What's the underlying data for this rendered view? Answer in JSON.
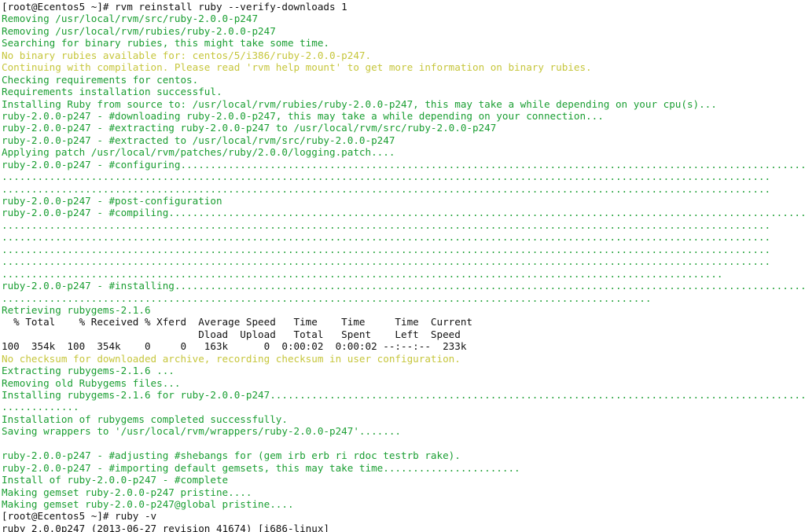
{
  "terminal": {
    "background_color": "#ffffff",
    "colors": {
      "green": "#1a9e32",
      "yellow": "#c6c63c",
      "black": "#111111"
    },
    "prompt": "[root@Ecentos5 ~]#",
    "hostname": "Ecentos5",
    "user": "root",
    "cwd": "~",
    "commands": [
      "rvm reinstall ruby --verify-downloads 1",
      "ruby -v"
    ],
    "lines": [
      {
        "color": "black",
        "text": "[root@Ecentos5 ~]# rvm reinstall ruby --verify-downloads 1"
      },
      {
        "color": "green",
        "text": "Removing /usr/local/rvm/src/ruby-2.0.0-p247"
      },
      {
        "color": "green",
        "text": "Removing /usr/local/rvm/rubies/ruby-2.0.0-p247"
      },
      {
        "color": "green",
        "text": "Searching for binary rubies, this might take some time."
      },
      {
        "color": "yellow",
        "text": "No binary rubies available for: centos/5/i386/ruby-2.0.0-p247."
      },
      {
        "color": "yellow",
        "text": "Continuing with compilation. Please read 'rvm help mount' to get more information on binary rubies."
      },
      {
        "color": "green",
        "text": "Checking requirements for centos."
      },
      {
        "color": "green",
        "text": "Requirements installation successful."
      },
      {
        "color": "green",
        "text": "Installing Ruby from source to: /usr/local/rvm/rubies/ruby-2.0.0-p247, this may take a while depending on your cpu(s)..."
      },
      {
        "color": "green",
        "text": "ruby-2.0.0-p247 - #downloading ruby-2.0.0-p247, this may take a while depending on your connection..."
      },
      {
        "color": "green",
        "text": "ruby-2.0.0-p247 - #extracting ruby-2.0.0-p247 to /usr/local/rvm/src/ruby-2.0.0-p247"
      },
      {
        "color": "green",
        "text": "ruby-2.0.0-p247 - #extracted to /usr/local/rvm/src/ruby-2.0.0-p247"
      },
      {
        "color": "green",
        "text": "Applying patch /usr/local/rvm/patches/ruby/2.0.0/logging.patch...."
      },
      {
        "color": "green",
        "text": "ruby-2.0.0-p247 - #configuring............................................................................................................"
      },
      {
        "color": "green",
        "text": "................................................................................................................................."
      },
      {
        "color": "green",
        "text": "................................................................................................................................."
      },
      {
        "color": "green",
        "text": "ruby-2.0.0-p247 - #post-configuration"
      },
      {
        "color": "green",
        "text": "ruby-2.0.0-p247 - #compiling.............................................................................................................."
      },
      {
        "color": "green",
        "text": "................................................................................................................................."
      },
      {
        "color": "green",
        "text": "................................................................................................................................."
      },
      {
        "color": "green",
        "text": "................................................................................................................................."
      },
      {
        "color": "green",
        "text": "................................................................................................................................."
      },
      {
        "color": "green",
        "text": "........................................................................................................................."
      },
      {
        "color": "green",
        "text": "ruby-2.0.0-p247 - #installing.............................................................................................................."
      },
      {
        "color": "green",
        "text": "............................................................................................................."
      },
      {
        "color": "green",
        "text": "Retrieving rubygems-2.1.6"
      },
      {
        "color": "black",
        "text": "  % Total    % Received % Xferd  Average Speed   Time    Time     Time  Current"
      },
      {
        "color": "black",
        "text": "                                 Dload  Upload   Total   Spent    Left  Speed"
      },
      {
        "color": "black",
        "text": "100  354k  100  354k    0     0   163k      0  0:00:02  0:00:02 --:--:--  233k"
      },
      {
        "color": "yellow",
        "text": "No checksum for downloaded archive, recording checksum in user configuration."
      },
      {
        "color": "green",
        "text": "Extracting rubygems-2.1.6 ..."
      },
      {
        "color": "green",
        "text": "Removing old Rubygems files..."
      },
      {
        "color": "green",
        "text": "Installing rubygems-2.1.6 for ruby-2.0.0-p247............................................................................................"
      },
      {
        "color": "green",
        "text": "............."
      },
      {
        "color": "green",
        "text": "Installation of rubygems completed successfully."
      },
      {
        "color": "green",
        "text": "Saving wrappers to '/usr/local/rvm/wrappers/ruby-2.0.0-p247'......."
      },
      {
        "color": "green",
        "text": ""
      },
      {
        "color": "green",
        "text": "ruby-2.0.0-p247 - #adjusting #shebangs for (gem irb erb ri rdoc testrb rake)."
      },
      {
        "color": "green",
        "text": "ruby-2.0.0-p247 - #importing default gemsets, this may take time......................."
      },
      {
        "color": "green",
        "text": "Install of ruby-2.0.0-p247 - #complete"
      },
      {
        "color": "green",
        "text": "Making gemset ruby-2.0.0-p247 pristine...."
      },
      {
        "color": "green",
        "text": "Making gemset ruby-2.0.0-p247@global pristine...."
      },
      {
        "color": "black",
        "text": "[root@Ecentos5 ~]# ruby -v"
      },
      {
        "color": "black",
        "text": "ruby 2.0.0p247 (2013-06-27 revision 41674) [i686-linux]"
      }
    ],
    "curl_progress": {
      "headers_row1": [
        "% Total",
        "% Received",
        "% Xferd",
        "Average Speed",
        "Time",
        "Time",
        "Time",
        "Current"
      ],
      "headers_row2": [
        "Dload",
        "Upload",
        "Total",
        "Spent",
        "Left",
        "Speed"
      ],
      "values": {
        "percent_total": "100",
        "total": "354k",
        "percent_received": "100",
        "received": "354k",
        "percent_xferd": "0",
        "xferd": "0",
        "dload": "163k",
        "upload": "0",
        "time_total": "0:00:02",
        "time_spent": "0:00:02",
        "time_left": "--:--:--",
        "current_speed": "233k"
      }
    },
    "ruby_version": {
      "version": "2.0.0p247",
      "date": "2013-06-27",
      "revision": "41674",
      "platform": "i686-linux"
    }
  }
}
